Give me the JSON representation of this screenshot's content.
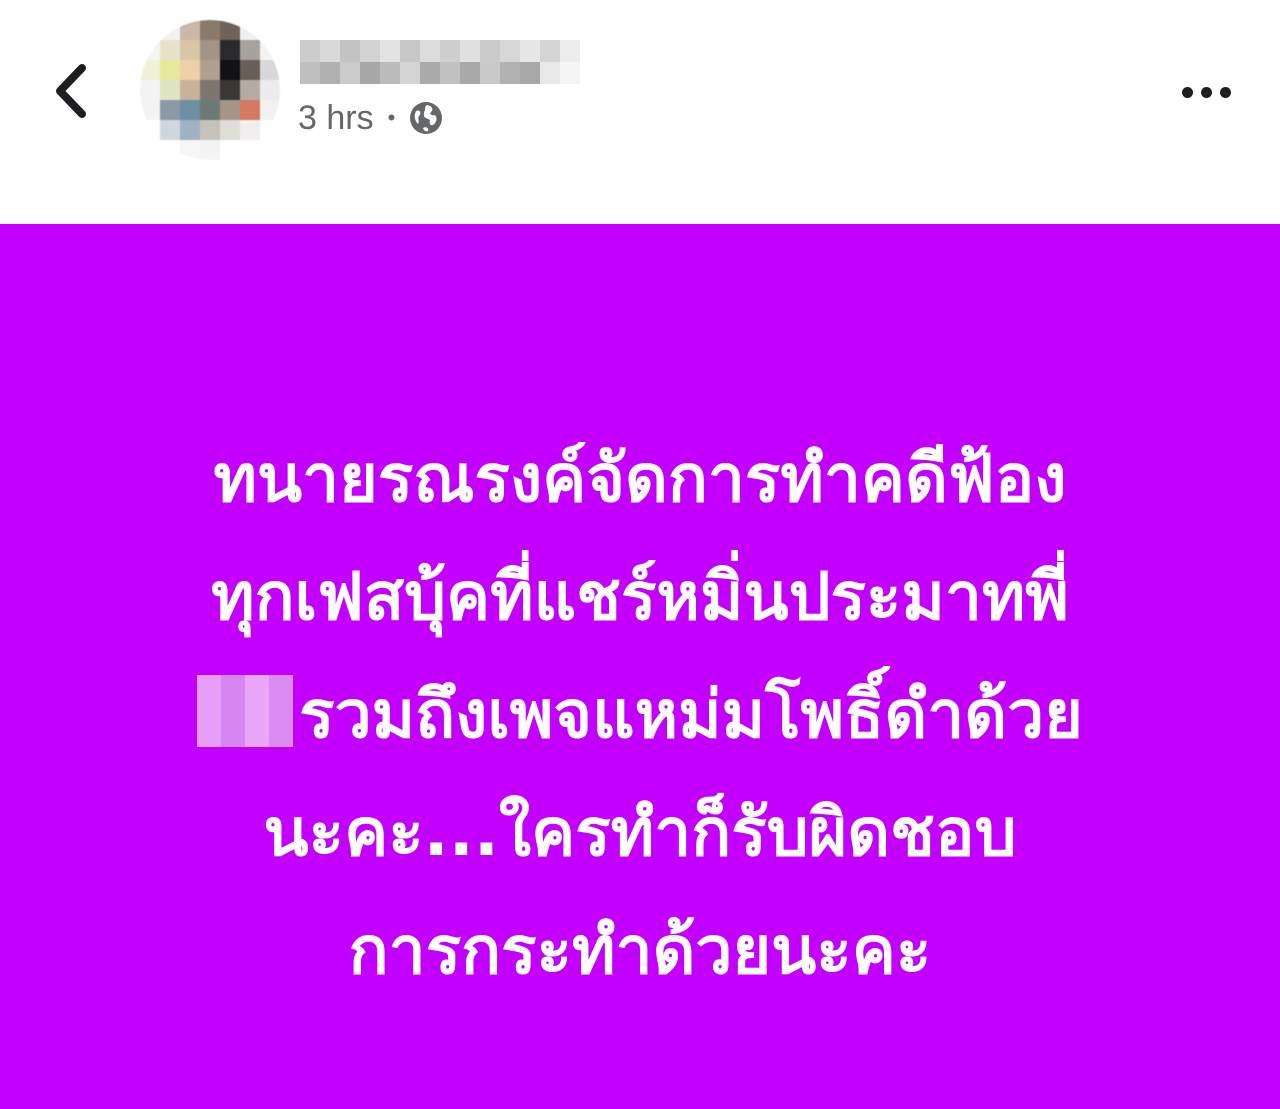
{
  "header": {
    "time_label": "3 hrs",
    "separator": "•",
    "privacy_icon": "globe-icon",
    "back_icon": "chevron-left-icon",
    "more_icon": "more-horizontal-icon"
  },
  "post": {
    "background_color": "#c300ff",
    "text_color": "#ffffff",
    "lines": [
      "ทนายรณรงค์จัดการทำคดีฟ้อง",
      "ทุกเฟสบุ้คที่แชร์หมิ่นประมาทพี่",
      "รวมถึงเพจแหม่มโพธิ์ดำด้วย",
      "นะคะ...ใครทำก็รับผิดชอบ",
      "การกระทำด้วยนะคะ"
    ]
  }
}
